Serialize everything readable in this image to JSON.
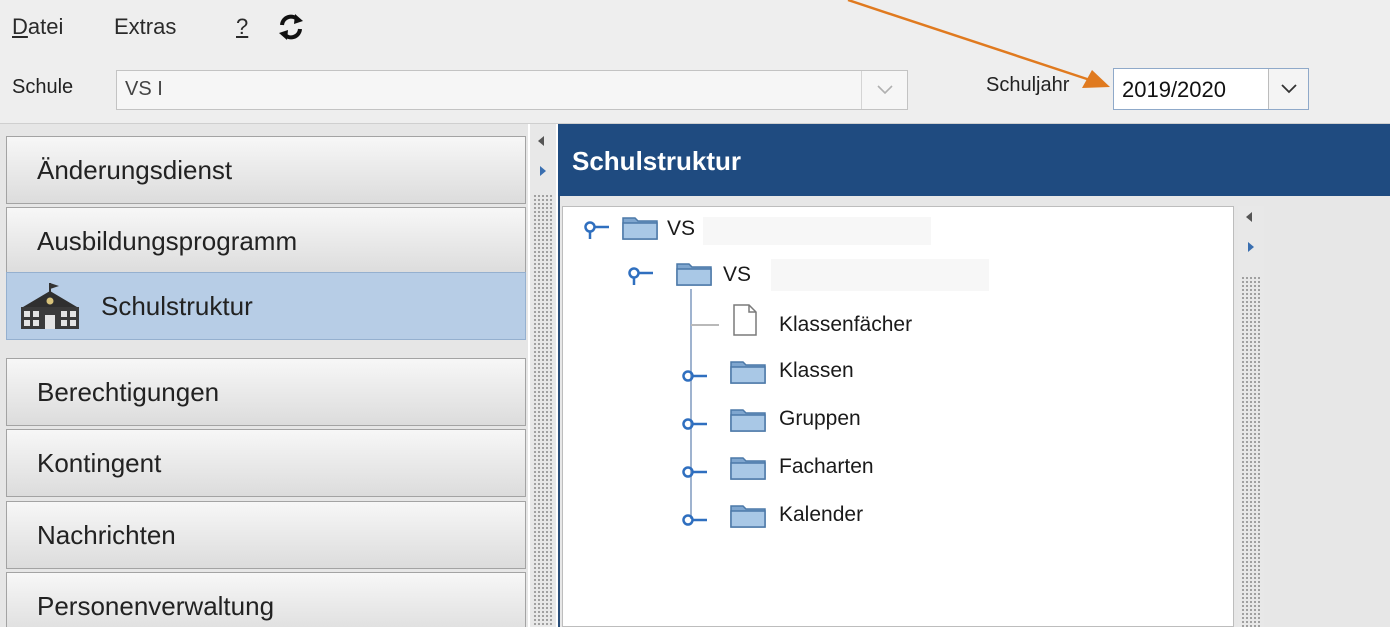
{
  "menu": {
    "datei": {
      "mnemonic": "D",
      "rest": "atei"
    },
    "extras": "Extras",
    "help": "?"
  },
  "toolbar": {
    "school_label": "Schule",
    "school_value": "VS I",
    "year_label": "Schuljahr",
    "year_value": "2019/2020"
  },
  "nav": {
    "items": [
      {
        "label": "Änderungsdienst"
      },
      {
        "label": "Ausbildungsprogramm"
      },
      {
        "label": "Schulstruktur",
        "icon": "school-icon",
        "active": true
      },
      {
        "label": "Berechtigungen"
      },
      {
        "label": "Kontingent"
      },
      {
        "label": "Nachrichten"
      },
      {
        "label": "Personenverwaltung"
      }
    ]
  },
  "panel": {
    "title": "Schulstruktur"
  },
  "tree": {
    "root": {
      "label": "VS",
      "icon": "folder-icon"
    },
    "child": {
      "label": "VS",
      "icon": "folder-icon"
    },
    "items": [
      {
        "label": "Klassenfächer",
        "icon": "document-icon"
      },
      {
        "label": "Klassen",
        "icon": "folder-icon"
      },
      {
        "label": "Gruppen",
        "icon": "folder-icon"
      },
      {
        "label": "Facharten",
        "icon": "folder-icon"
      },
      {
        "label": "Kalender",
        "icon": "folder-icon"
      }
    ]
  },
  "colors": {
    "header_blue": "#1f4b80",
    "active_nav": "#b7cde6",
    "annotation_arrow": "#e07a1f"
  }
}
